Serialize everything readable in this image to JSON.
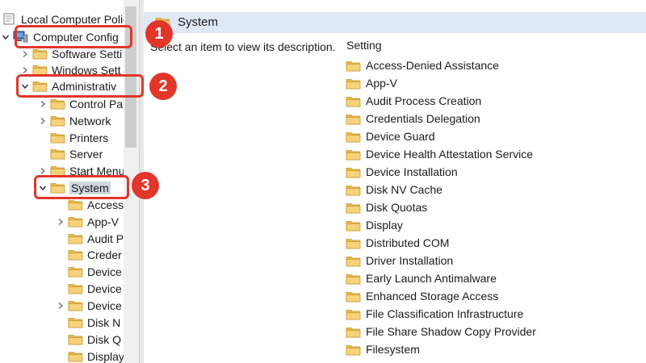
{
  "tree": {
    "root_label": "Local Computer Polic",
    "computer_config_label": "Computer Config",
    "software_settings_label": "Software Setti",
    "windows_settings_label": "Windows Sett",
    "admin_templates_label": "Administrativ",
    "control_panel_label": "Control Pa",
    "network_label": "Network",
    "printers_label": "Printers",
    "server_label": "Server",
    "start_menu_label": "Start Menu",
    "system_label": "System",
    "system_children": [
      "Access",
      "App-V",
      "Audit P",
      "Creder",
      "Device",
      "Device",
      "Device",
      "Disk N",
      "Disk Q",
      "Display"
    ]
  },
  "right_pane": {
    "title": "System",
    "description": "Select an item to view its description.",
    "column_header": "Setting",
    "settings": [
      "Access-Denied Assistance",
      "App-V",
      "Audit Process Creation",
      "Credentials Delegation",
      "Device Guard",
      "Device Health Attestation Service",
      "Device Installation",
      "Disk NV Cache",
      "Disk Quotas",
      "Display",
      "Distributed COM",
      "Driver Installation",
      "Early Launch Antimalware",
      "Enhanced Storage Access",
      "File Classification Infrastructure",
      "File Share Shadow Copy Provider",
      "Filesystem"
    ]
  },
  "annotations": {
    "step1": "1",
    "step2": "2",
    "step3": "3",
    "color": "#e2362a"
  },
  "colors": {
    "folder_fill": "#f3c75f",
    "header_bg": "#dfe8f5",
    "selection_bg": "#d0d7e0"
  }
}
